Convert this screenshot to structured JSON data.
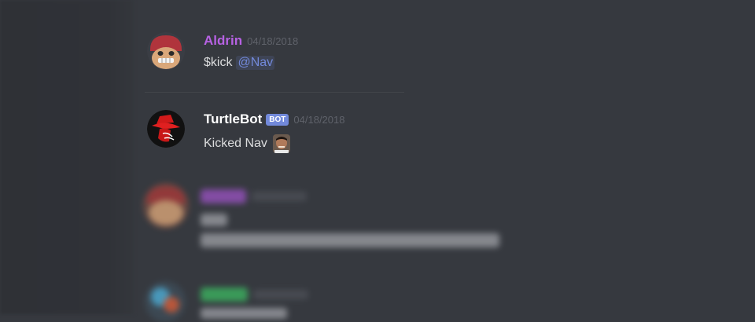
{
  "messages": [
    {
      "author": "Aldrin",
      "author_color": "#b762e3",
      "timestamp": "04/18/2018",
      "content": "$kick",
      "mention": "@Nav",
      "avatar_icon": "red-hat-character-avatar"
    },
    {
      "author": "TurtleBot",
      "author_color": "#ffffff",
      "bot_tag": "BOT",
      "timestamp": "04/18/2018",
      "content": "Kicked Nav",
      "avatar_icon": "red-top-hat-logo-avatar",
      "inline_icon": "nav-face-emoji"
    }
  ],
  "blurred_messages": [
    {
      "author_color": "#8c4fb0",
      "avatar_icon": "red-hat-character-avatar"
    },
    {
      "author_color": "#3ba55c",
      "avatar_icon": "blue-character-avatar"
    }
  ],
  "colors": {
    "background": "#36393f",
    "sidebar": "#2f3136",
    "mention": "#7289da",
    "bot_tag": "#7289da",
    "timestamp": "#5f626a"
  }
}
